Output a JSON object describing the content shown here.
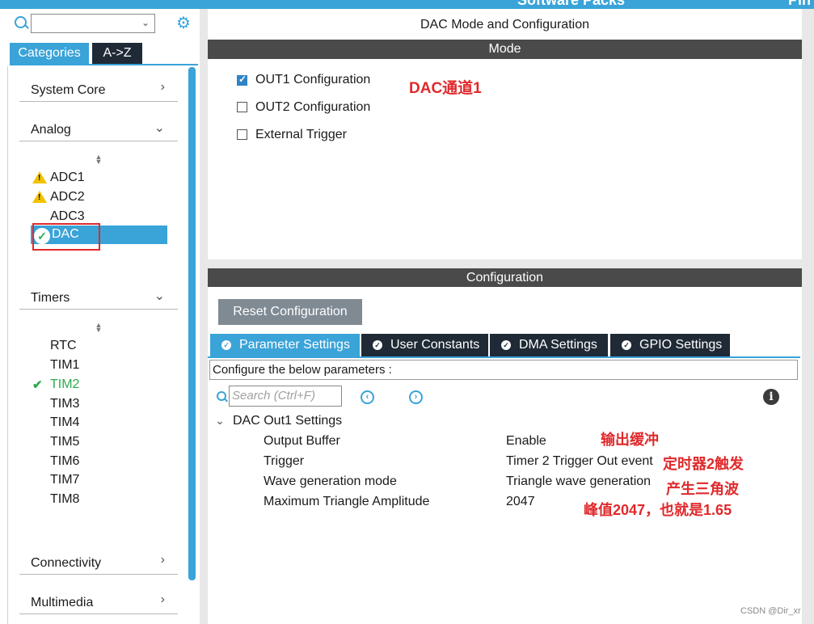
{
  "top_strip": {
    "tab_partial": "Software Packs",
    "tab_partial2": "Pin"
  },
  "sidebar": {
    "search_placeholder": "",
    "tabs": [
      {
        "label": "Categories"
      },
      {
        "label": "A->Z"
      }
    ],
    "categories": [
      {
        "label": "System Core",
        "expanded": false
      },
      {
        "label": "Analog",
        "expanded": true
      },
      {
        "label": "Timers",
        "expanded": true
      },
      {
        "label": "Connectivity",
        "expanded": false
      },
      {
        "label": "Multimedia",
        "expanded": false
      }
    ],
    "analog_items": [
      {
        "label": "ADC1",
        "status": "warning"
      },
      {
        "label": "ADC2",
        "status": "warning"
      },
      {
        "label": "ADC3",
        "status": "none"
      },
      {
        "label": "DAC",
        "status": "ok",
        "selected": true
      }
    ],
    "timer_items": [
      {
        "label": "RTC"
      },
      {
        "label": "TIM1"
      },
      {
        "label": "TIM2",
        "status": "ok"
      },
      {
        "label": "TIM3"
      },
      {
        "label": "TIM4"
      },
      {
        "label": "TIM5"
      },
      {
        "label": "TIM6"
      },
      {
        "label": "TIM7"
      },
      {
        "label": "TIM8"
      }
    ]
  },
  "panel": {
    "title": "DAC Mode and Configuration",
    "mode_header": "Mode",
    "mode_options": [
      {
        "label": "OUT1 Configuration",
        "checked": true
      },
      {
        "label": "OUT2 Configuration",
        "checked": false
      },
      {
        "label": "External Trigger",
        "checked": false
      }
    ],
    "configuration_header": "Configuration",
    "reset_label": "Reset Configuration",
    "tabs": [
      {
        "label": "Parameter Settings",
        "active": true
      },
      {
        "label": "User Constants"
      },
      {
        "label": "DMA Settings"
      },
      {
        "label": "GPIO Settings"
      }
    ],
    "configure_text": "Configure the below parameters :",
    "search_placeholder": "Search (Ctrl+F)",
    "group_label": "DAC Out1 Settings",
    "params": [
      {
        "name": "Output Buffer",
        "value": "Enable"
      },
      {
        "name": "Trigger",
        "value": "Timer 2 Trigger Out event"
      },
      {
        "name": "Wave generation mode",
        "value": "Triangle wave generation"
      },
      {
        "name": "Maximum Triangle Amplitude",
        "value": "2047"
      }
    ]
  },
  "annotations": {
    "dac_channel": "DAC通道1",
    "output_buffer": "输出缓冲",
    "trigger": "定时器2触发",
    "wave": "产生三角波",
    "amplitude": "峰值2047，也就是1.65"
  },
  "watermark": "CSDN @Dir_xr",
  "colors": {
    "accent": "#3aa3d8",
    "dark": "#1f2a36",
    "header": "#4a4a4a",
    "annotation": "#e0292b",
    "ok": "#2fa84f",
    "warning": "#f2c200"
  }
}
